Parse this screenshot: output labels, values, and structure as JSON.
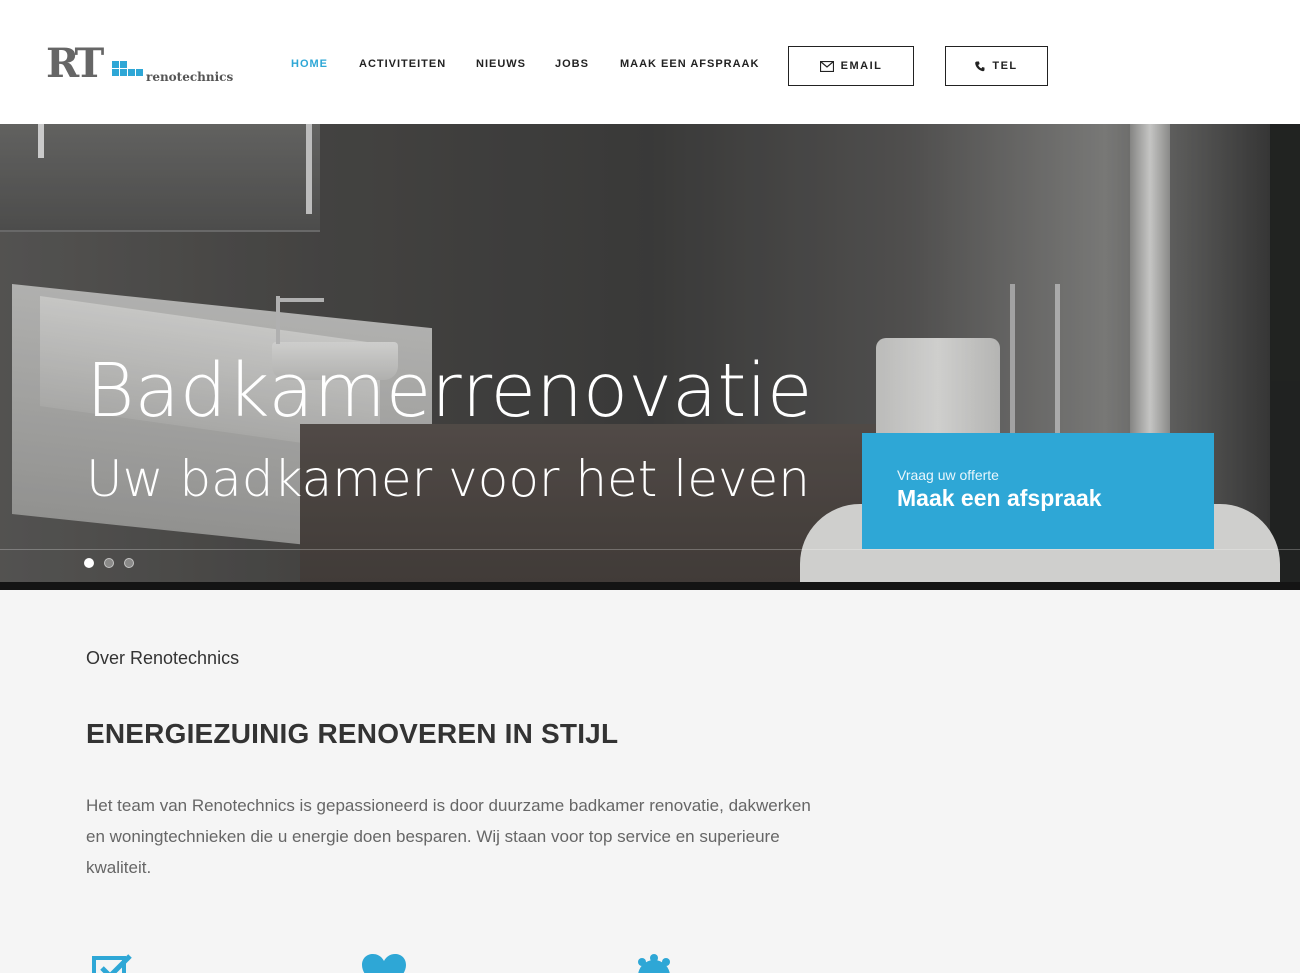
{
  "brand": {
    "logo_letters": "RT",
    "logo_word": "renotechnics",
    "accent_color": "#2ea7d6"
  },
  "nav": {
    "items": [
      {
        "label": "HOME",
        "active": true
      },
      {
        "label": "ACTIVITEITEN",
        "active": false
      },
      {
        "label": "NIEUWS",
        "active": false
      },
      {
        "label": "JOBS",
        "active": false
      },
      {
        "label": "MAAK EEN AFSPRAAK",
        "active": false
      }
    ],
    "email_button": {
      "label": "EMAIL",
      "icon": "envelope-icon"
    },
    "tel_button": {
      "label": "TEL",
      "icon": "phone-icon"
    }
  },
  "hero": {
    "title": "Badkamerrenovatie",
    "subtitle": "Uw badkamer voor het leven",
    "slides": 3,
    "active_slide": 1,
    "cta": {
      "small": "Vraag uw offerte",
      "big": "Maak een afspraak"
    }
  },
  "about": {
    "eyebrow": "Over Renotechnics",
    "headline": "ENERGIEZUINIG RENOVEREN IN STIJL",
    "paragraph": "Het team van Renotechnics is gepassioneerd is door duurzame badkamer renovatie, dakwerken en woningtechnieken die u energie doen besparen. Wij staan voor top service en superieure kwaliteit."
  },
  "features": {
    "icons": [
      "edit-check-icon",
      "heart-icon",
      "badge-icon"
    ]
  }
}
